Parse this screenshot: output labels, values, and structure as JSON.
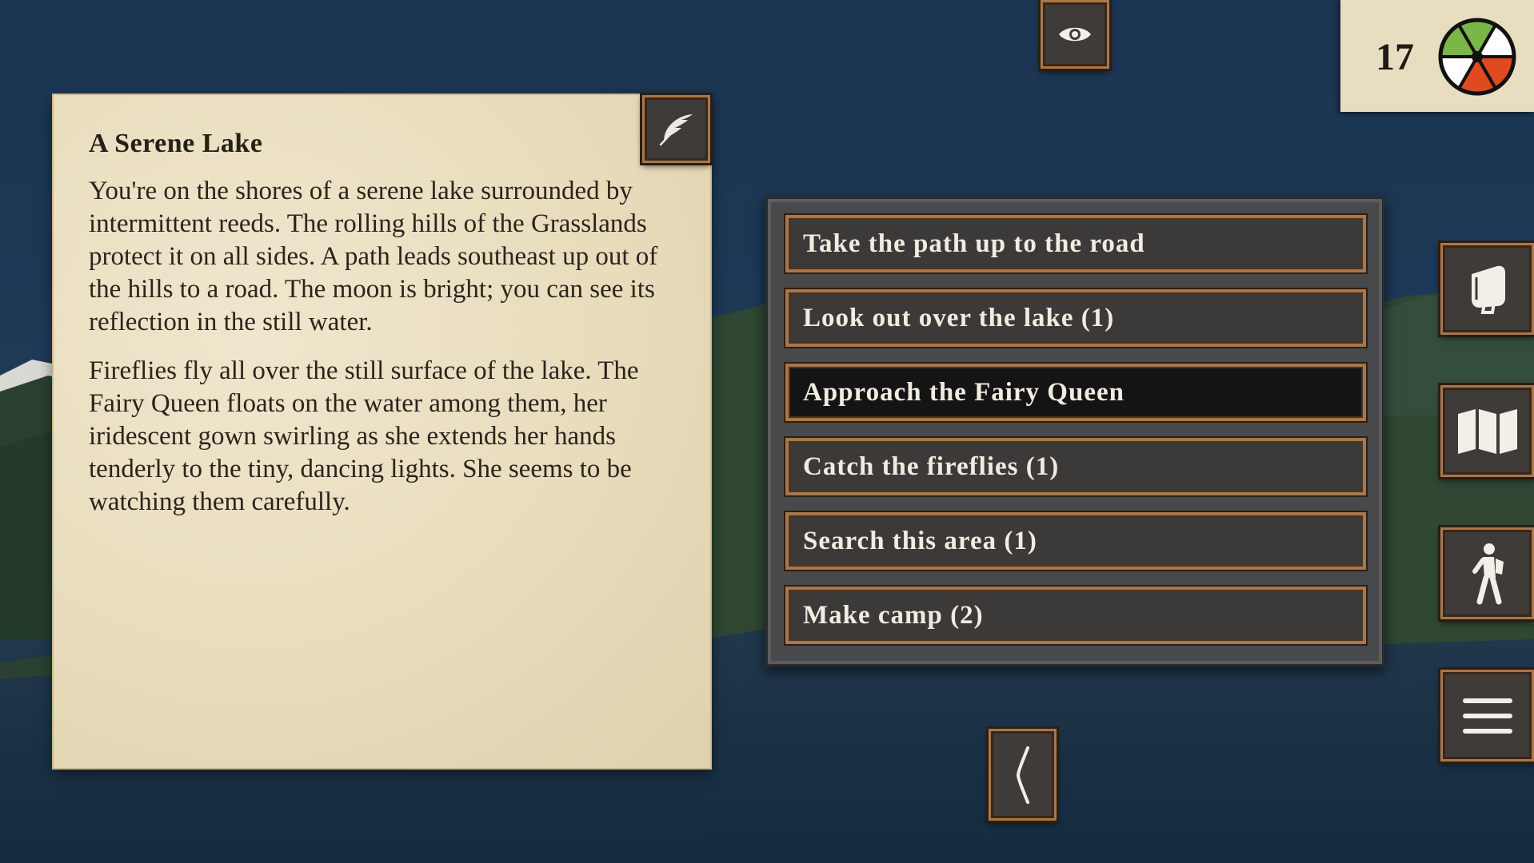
{
  "story": {
    "title": "A Serene Lake",
    "paragraphs": [
      "You're on the shores of a serene lake surrounded by intermittent reeds. The rolling hills of the Grasslands protect it on all sides. A path leads southeast up out of the hills to a road. The moon is bright; you can see its reflection in the still water.",
      "Fireflies fly all over the still surface of the lake. The Fairy Queen floats on the water among them, her iridescent gown swirling as she extends her hands tenderly to the tiny, dancing lights. She seems to be watching them carefully."
    ],
    "journal_icon": "quill-icon"
  },
  "choices": [
    {
      "label": "Take the path up to the road",
      "selected": false
    },
    {
      "label": "Look out over the lake (1)",
      "selected": false
    },
    {
      "label": "Approach the Fairy Queen",
      "selected": true
    },
    {
      "label": "Catch the fireflies (1)",
      "selected": false
    },
    {
      "label": "Search this area (1)",
      "selected": false
    },
    {
      "label": "Make camp (2)",
      "selected": false
    }
  ],
  "status": {
    "day_count": "17",
    "wheel_colors": [
      "#7ab648",
      "#ffffff",
      "#e04a1f",
      "#e04a1f",
      "#ffffff",
      "#7ab648"
    ]
  },
  "toolbar": {
    "top": "eye-icon",
    "side": [
      "inventory-icon",
      "map-icon",
      "hiker-icon",
      "menu-icon"
    ],
    "bottom": "back-icon"
  },
  "colors": {
    "sky": "#17314b",
    "parchment": "#e8dcbc",
    "frame": "#a9774b",
    "button_fill": "#3c3a39",
    "selected_fill": "#151414"
  }
}
